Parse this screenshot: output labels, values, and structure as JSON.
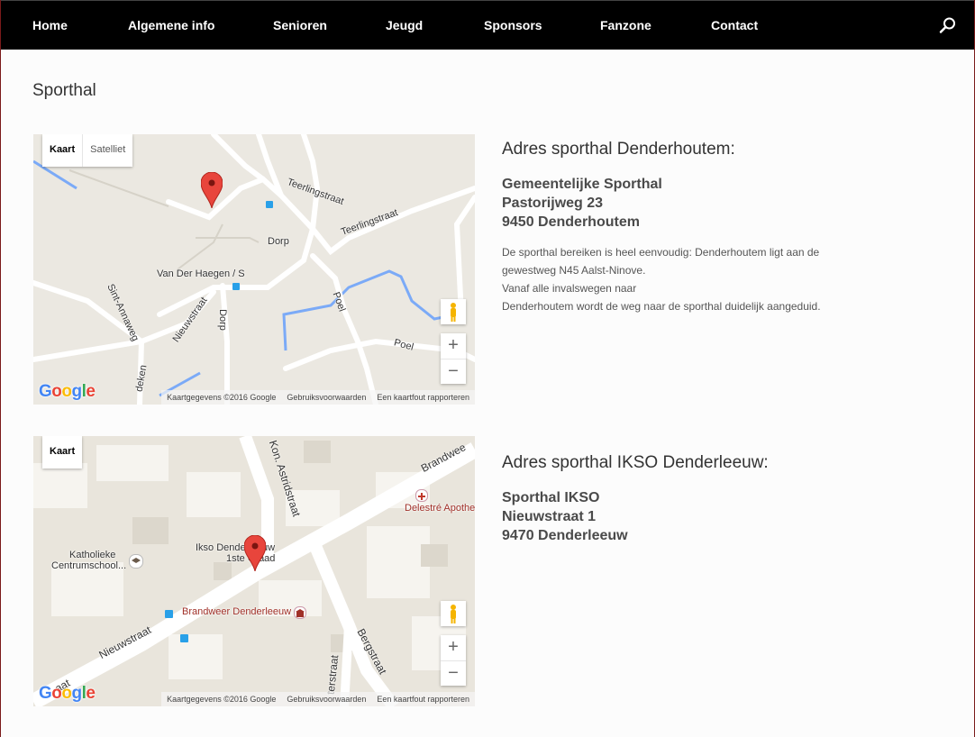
{
  "nav": {
    "items": [
      "Home",
      "Algemene info",
      "Senioren",
      "Jeugd",
      "Sponsors",
      "Fanzone",
      "Contact"
    ],
    "search_icon": "search-icon"
  },
  "page": {
    "title": "Sporthal"
  },
  "maps": [
    {
      "type_buttons": [
        "Kaart",
        "Satelliet"
      ],
      "zoom_in": "+",
      "zoom_out": "−",
      "logo": "Google",
      "attribution": [
        "Kaartgegevens ©2016 Google",
        "Gebruiksvoorwaarden",
        "Een kaartfout rapporteren"
      ],
      "labels": [
        "Teerlingstraat",
        "Teerlingstraat",
        "Dorp",
        "Van Der Haegen / S",
        "Poel",
        "Poel",
        "Sint-Annaweg",
        "Nieuwstraat",
        "Dorp",
        "deken"
      ]
    },
    {
      "type_buttons": [
        "Kaart"
      ],
      "zoom_in": "+",
      "zoom_out": "−",
      "logo": "Google",
      "attribution": [
        "Kaartgegevens ©2016 Google",
        "Gebruiksvoorwaarden",
        "Een kaartfout rapporteren"
      ],
      "labels": [
        "Kon. Astridstraat",
        "Brandwee",
        "Delestré Apothe",
        "Ikso Denderleeuw",
        "1ste Graad",
        "Katholieke",
        "Centrumschool...",
        "Brandweer Denderleeuw",
        "Nieuwstraat",
        "Bergstraat",
        "terstraat",
        "aat"
      ]
    }
  ],
  "locations": [
    {
      "heading": "Adres sporthal Denderhoutem:",
      "address": [
        "Gemeentelijke Sporthal",
        "Pastorijweg 23",
        "9450 Denderhoutem"
      ],
      "description": [
        "De sporthal bereiken is heel eenvoudig: Denderhoutem ligt aan de",
        "gewestweg N45 Aalst-Ninove.",
        "Vanaf alle invalswegen naar",
        "Denderhoutem wordt de weg naar de sporthal duidelijk aangeduid."
      ]
    },
    {
      "heading": "Adres sporthal IKSO Denderleeuw:",
      "address": [
        "Sporthal IKSO",
        "Nieuwstraat 1",
        "9470 Denderleeuw"
      ]
    }
  ],
  "colors": {
    "nav_bg": "#000000",
    "map_land": "#ebe8e1",
    "road": "#ffffff",
    "water": "#7baaf7",
    "marker": "#e8453c"
  }
}
